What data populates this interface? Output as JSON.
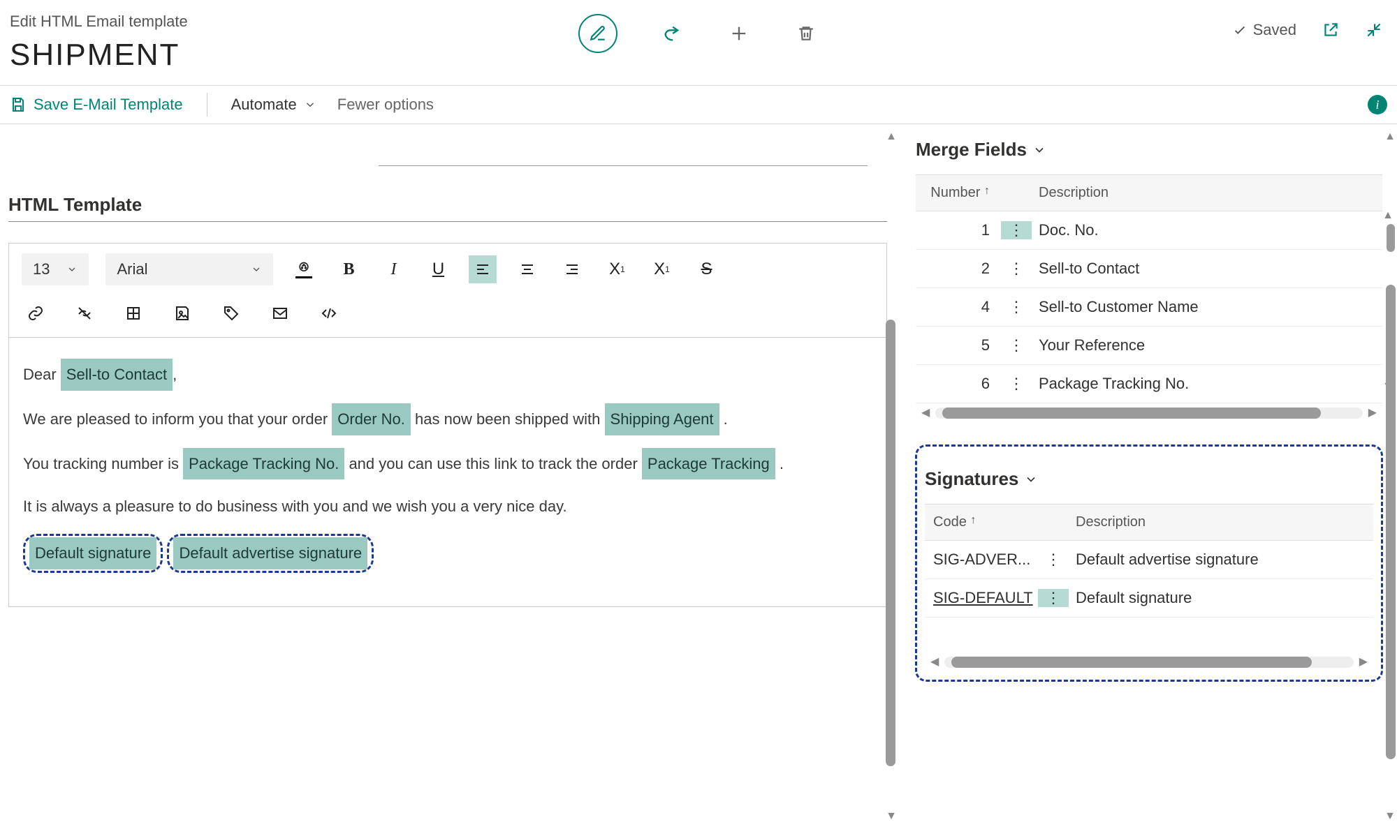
{
  "header": {
    "breadcrumb": "Edit HTML Email template",
    "title": "SHIPMENT",
    "saved_label": "Saved"
  },
  "actions": {
    "save_template": "Save E-Mail Template",
    "automate": "Automate",
    "fewer_options": "Fewer options"
  },
  "editor": {
    "section_title": "HTML Template",
    "font_size": "13",
    "font_family": "Arial",
    "body": {
      "line1_pre": "Dear ",
      "line1_chip": "Sell-to Contact",
      "line1_post": ",",
      "line2_pre": "We are pleased to inform you that your order ",
      "line2_chip1": "Order No.",
      "line2_mid": " has now been shipped with ",
      "line2_chip2": "Shipping Agent",
      "line2_post": " .",
      "line3_pre": "You tracking number is ",
      "line3_chip1": "Package Tracking No.",
      "line3_mid": " and you can use this link to track the order ",
      "line3_chip2": "Package Tracking",
      "line3_post": " .",
      "line4": "It is always a pleasure to do business with you and we wish you a very nice day.",
      "sig1": "Default signature",
      "sig2": "Default advertise signature"
    }
  },
  "merge_fields": {
    "title": "Merge Fields",
    "col_number": "Number",
    "col_description": "Description",
    "rows": [
      {
        "num": "1",
        "desc": "Doc. No."
      },
      {
        "num": "2",
        "desc": "Sell-to Contact"
      },
      {
        "num": "4",
        "desc": "Sell-to Customer Name"
      },
      {
        "num": "5",
        "desc": "Your Reference"
      },
      {
        "num": "6",
        "desc": "Package Tracking No."
      }
    ]
  },
  "signatures": {
    "title": "Signatures",
    "col_code": "Code",
    "col_description": "Description",
    "rows": [
      {
        "code": "SIG-ADVER...",
        "desc": "Default advertise signature"
      },
      {
        "code": "SIG-DEFAULT",
        "desc": "Default signature"
      }
    ]
  }
}
